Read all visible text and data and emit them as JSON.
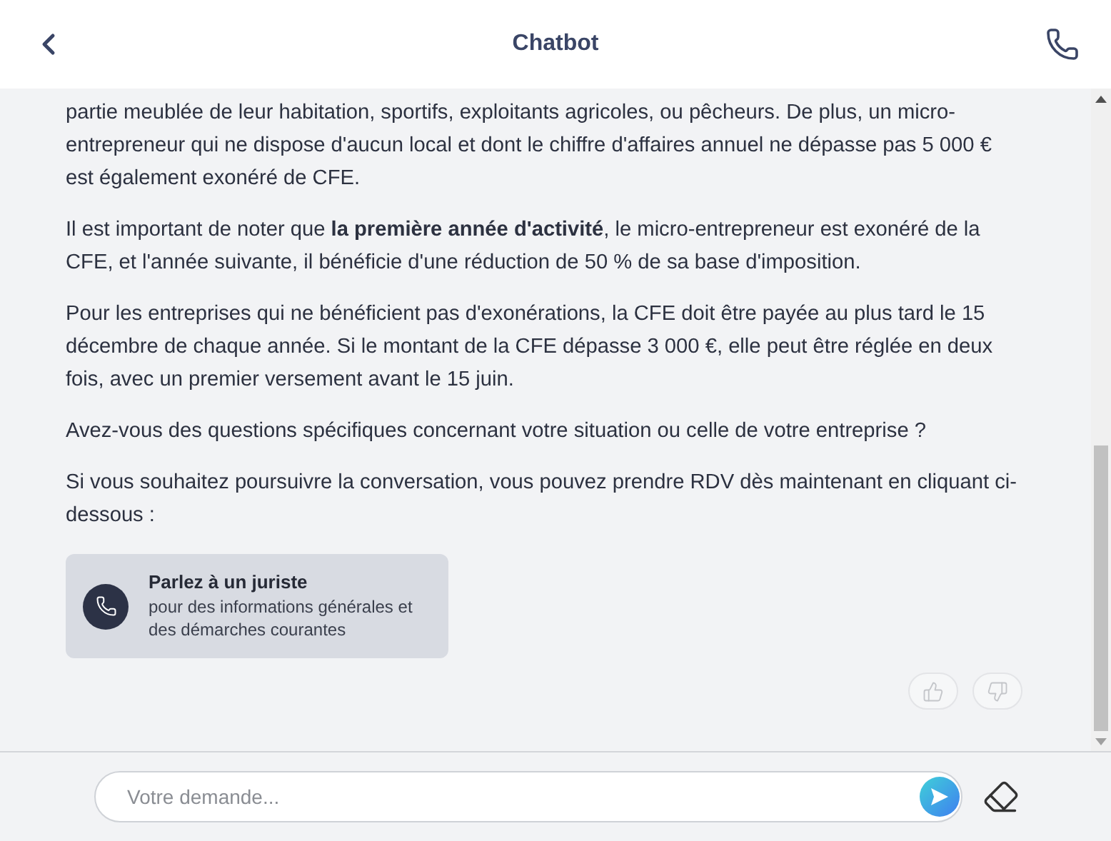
{
  "header": {
    "title": "Chatbot"
  },
  "message": {
    "paragraphs": [
      "partie meublée de leur habitation, sportifs, exploitants agricoles, ou pêcheurs. De plus, un micro-entrepreneur qui ne dispose d'aucun local et dont le chiffre d'affaires annuel ne dépasse pas 5 000 € est également exonéré de CFE.",
      "Il est important de noter que **la première année d'activité**, le micro-entrepreneur est exonéré de la CFE, et l'année suivante, il bénéficie d'une réduction de 50 % de sa base d'imposition.",
      "Pour les entreprises qui ne bénéficient pas d'exonérations, la CFE doit être payée au plus tard le 15 décembre de chaque année. Si le montant de la CFE dépasse 3 000 €, elle peut être réglée en deux fois, avec un premier versement avant le 15 juin.",
      "Avez-vous des questions spécifiques concernant votre situation ou celle de votre entreprise ?",
      "Si vous souhaitez poursuivre la conversation, vous pouvez prendre RDV dès maintenant en cliquant ci-dessous :"
    ],
    "card": {
      "title": "Parlez à un juriste",
      "subtitle": "pour des informations générales et des démarches courantes"
    }
  },
  "input": {
    "placeholder": "Votre demande..."
  }
}
